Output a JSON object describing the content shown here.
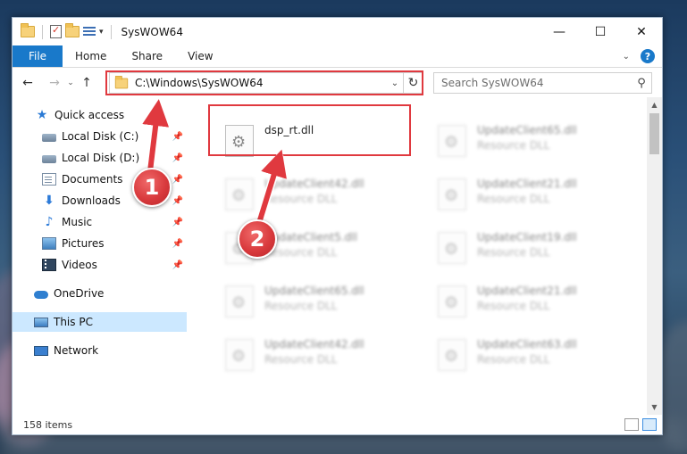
{
  "window": {
    "title": "SysWOW64",
    "minimize": "—",
    "maximize": "☐",
    "close": "✕"
  },
  "ribbon": {
    "tabs": [
      "File",
      "Home",
      "Share",
      "View"
    ]
  },
  "address": {
    "path": "C:\\Windows\\SysWOW64"
  },
  "search": {
    "placeholder": "Search SysWOW64"
  },
  "nav": {
    "items": [
      {
        "label": "Quick access",
        "icon": "star-icon"
      },
      {
        "label": "Local Disk (C:)",
        "icon": "drive-icon",
        "pinned": true
      },
      {
        "label": "Local Disk (D:)",
        "icon": "drive-icon",
        "pinned": true
      },
      {
        "label": "Documents",
        "icon": "documents-icon",
        "pinned": true
      },
      {
        "label": "Downloads",
        "icon": "download-icon",
        "pinned": true
      },
      {
        "label": "Music",
        "icon": "music-icon",
        "pinned": true
      },
      {
        "label": "Pictures",
        "icon": "pictures-icon",
        "pinned": true
      },
      {
        "label": "Videos",
        "icon": "videos-icon",
        "pinned": true
      },
      {
        "label": "OneDrive",
        "icon": "cloud-icon"
      },
      {
        "label": "This PC",
        "icon": "computer-icon",
        "selected": true
      },
      {
        "label": "Network",
        "icon": "network-icon"
      }
    ]
  },
  "files": [
    {
      "name": "dsp_rt.dll",
      "type": ""
    },
    {
      "name": "UpdateClient65.dll",
      "type": "Resource DLL"
    },
    {
      "name": "UpdateClient42.dll",
      "type": "Resource DLL"
    },
    {
      "name": "UpdateClient21.dll",
      "type": "Resource DLL"
    },
    {
      "name": "UpdateClient5.dll",
      "type": "Resource DLL"
    },
    {
      "name": "UpdateClient19.dll",
      "type": "Resource DLL"
    },
    {
      "name": "UpdateClient65.dll",
      "type": "Resource DLL"
    },
    {
      "name": "UpdateClient21.dll",
      "type": "Resource DLL"
    },
    {
      "name": "UpdateClient42.dll",
      "type": "Resource DLL"
    },
    {
      "name": "UpdateClient63.dll",
      "type": "Resource DLL"
    }
  ],
  "status": {
    "item_count": "158 items"
  },
  "annotations": {
    "step1": "1",
    "step2": "2",
    "color": "#e0393f"
  }
}
